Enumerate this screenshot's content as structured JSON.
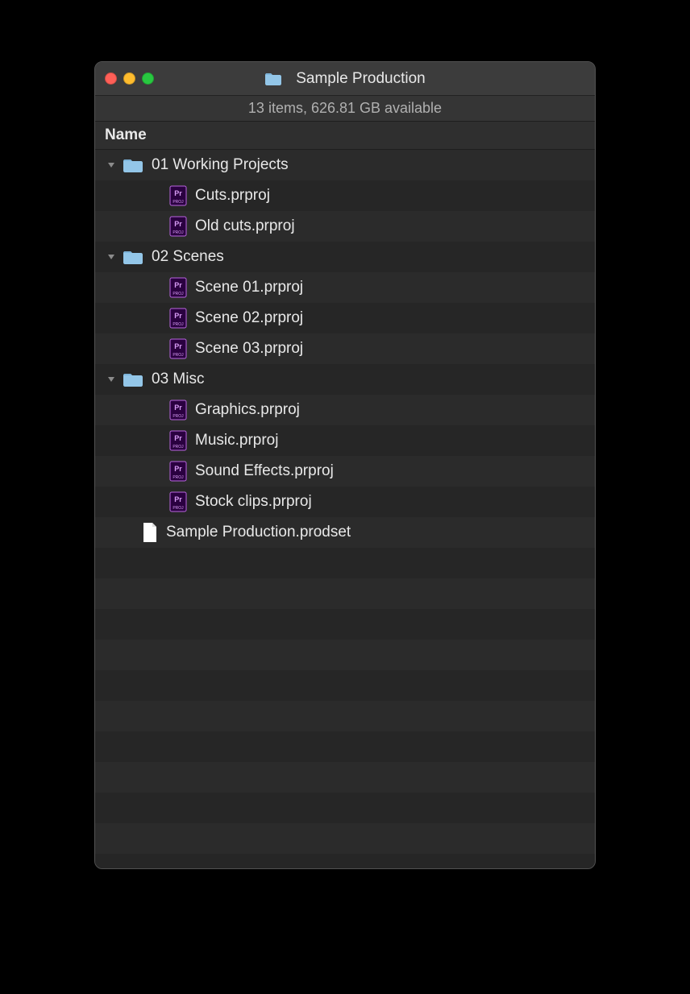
{
  "window": {
    "title": "Sample Production",
    "status": "13 items, 626.81 GB available",
    "column_name": "Name"
  },
  "items": [
    {
      "type": "folder",
      "label": "01 Working Projects",
      "expanded": true,
      "children": [
        {
          "type": "prproj",
          "label": "Cuts.prproj"
        },
        {
          "type": "prproj",
          "label": "Old cuts.prproj"
        }
      ]
    },
    {
      "type": "folder",
      "label": "02 Scenes",
      "expanded": true,
      "children": [
        {
          "type": "prproj",
          "label": "Scene 01.prproj"
        },
        {
          "type": "prproj",
          "label": "Scene 02.prproj"
        },
        {
          "type": "prproj",
          "label": "Scene 03.prproj"
        }
      ]
    },
    {
      "type": "folder",
      "label": "03 Misc",
      "expanded": true,
      "children": [
        {
          "type": "prproj",
          "label": "Graphics.prproj"
        },
        {
          "type": "prproj",
          "label": "Music.prproj"
        },
        {
          "type": "prproj",
          "label": "Sound Effects.prproj"
        },
        {
          "type": "prproj",
          "label": "Stock clips.prproj"
        }
      ]
    },
    {
      "type": "doc",
      "label": "Sample Production.prodset"
    }
  ]
}
